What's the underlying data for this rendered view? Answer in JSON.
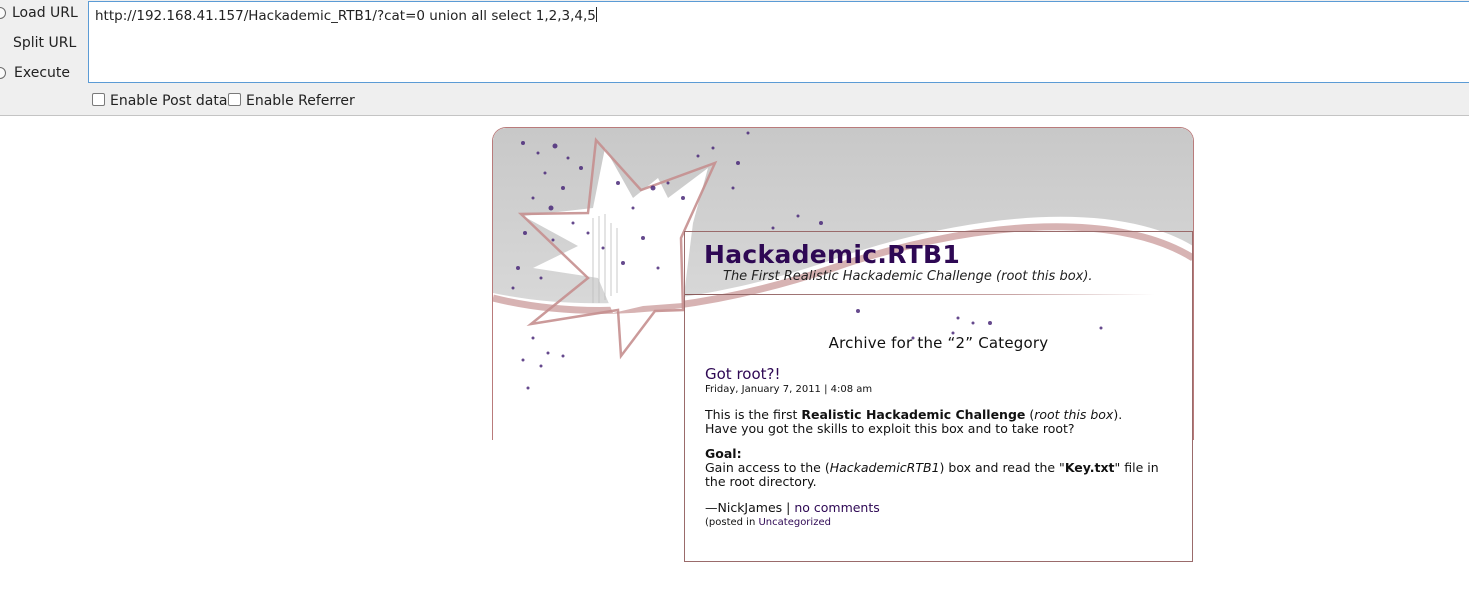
{
  "hackbar": {
    "actions": {
      "load_url": "Load URL",
      "split_url": "Split URL",
      "execute": "Execute"
    },
    "url_value": "http://192.168.41.157/Hackademic_RTB1/?cat=0 union all select 1,2,3,4,5",
    "checkboxes": {
      "post_data": {
        "label": "Enable Post data",
        "checked": false
      },
      "referrer": {
        "label": "Enable Referrer",
        "checked": false
      }
    }
  },
  "blog": {
    "title": "Hackademic.RTB1",
    "description": "The First Realistic Hackademic Challenge (root this box).",
    "archive_title": "Archive for the “2” Category",
    "post": {
      "title": "Got root?!",
      "date": "Friday, January 7, 2011 | 4:08 am",
      "intro_1": "This is the first ",
      "intro_bold": "Realistic Hackademic Challenge",
      "intro_2": " (",
      "intro_italic": "root this box",
      "intro_3": ").",
      "intro_line2": "Have you got the skills to exploit this box and to take root?",
      "goal_label": "Goal:",
      "goal_1": "Gain access to the (",
      "goal_italic": "HackademicRTB1",
      "goal_2": ") box and read the \"",
      "goal_bold": "Key.txt",
      "goal_3": "\" file in",
      "goal_line2": "the root directory.",
      "author": "—NickJames | ",
      "comments_link": "no comments",
      "posted_in": "(posted in ",
      "category_link": "Uncategorized"
    }
  },
  "colors": {
    "title": "#2e0854",
    "link": "#2e0854",
    "border": "#9a6b6b",
    "url_focus": "#5b9bd5",
    "toolbar_bg": "#efefef"
  }
}
